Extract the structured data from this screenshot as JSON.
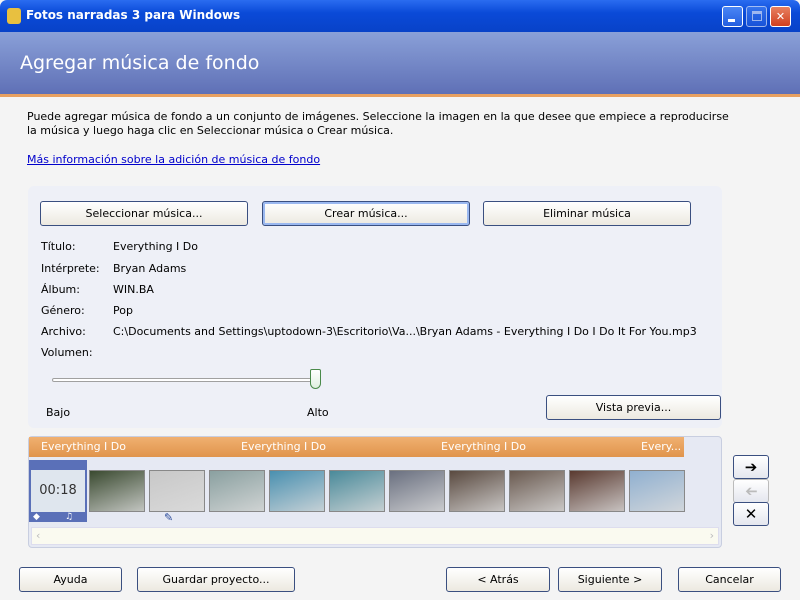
{
  "window": {
    "title": "Fotos narradas 3 para Windows",
    "icon": "app-icon"
  },
  "header": {
    "title": "Agregar música de fondo"
  },
  "intro": {
    "line1": "Puede agregar música de fondo a un conjunto de imágenes. Seleccione la imagen en la que desee que empiece a reproducirse",
    "line2": "la música y luego haga clic en Seleccionar música o Crear música.",
    "link": "Más información sobre la adición de música de fondo"
  },
  "buttons": {
    "select": "Seleccionar música...",
    "create": "Crear música...",
    "remove": "Eliminar música",
    "preview": "Vista previa..."
  },
  "info": {
    "labels": [
      "Título:",
      "Intérprete:",
      "Álbum:",
      "Género:",
      "Archivo:",
      "Volumen:"
    ],
    "values": [
      "Everything I Do",
      "Bryan Adams",
      "WIN.BA",
      "Pop",
      "C:\\Documents and Settings\\uptodown-3\\Escritorio\\Va...\\Bryan Adams - Everything I Do I Do It For You.mp3"
    ]
  },
  "volume": {
    "low": "Bajo",
    "high": "Alto",
    "level": 1.0
  },
  "timeline": {
    "track_labels": [
      "Everything I Do",
      "Everything I Do",
      "Everything I Do",
      "Every..."
    ],
    "first_duration": "00:18",
    "thumb_count": 11
  },
  "colors": {
    "track": "#e8a060",
    "accent": "#0a4ad8"
  },
  "footer": {
    "help": "Ayuda",
    "save": "Guardar proyecto...",
    "back": "< Atrás",
    "next": "Siguiente >",
    "cancel": "Cancelar"
  }
}
